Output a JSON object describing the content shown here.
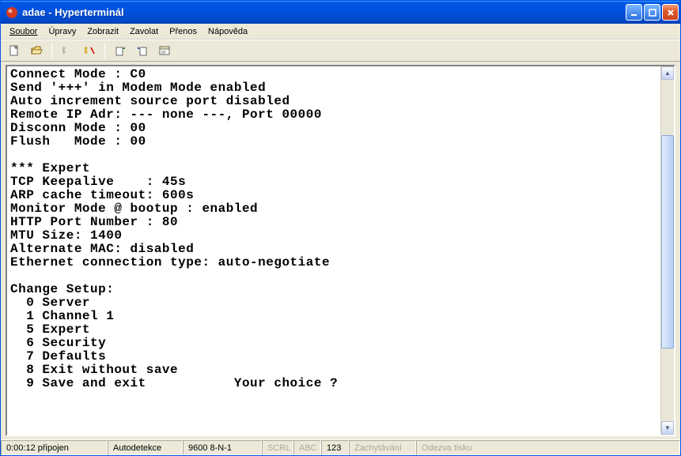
{
  "window": {
    "title": "adae - Hyperterminál"
  },
  "menu": {
    "file": "Soubor",
    "edit": "Úpravy",
    "view": "Zobrazit",
    "call": "Zavolat",
    "transfer": "Přenos",
    "help": "Nápověda"
  },
  "toolbar_icons": {
    "new": "new-file-icon",
    "open": "open-folder-icon",
    "connect": "phone-connect-icon",
    "disconnect": "phone-disconnect-icon",
    "send": "send-file-icon",
    "receive": "receive-file-icon",
    "properties": "properties-icon"
  },
  "terminal_lines": [
    "Connect Mode : C0",
    "Send '+++' in Modem Mode enabled",
    "Auto increment source port disabled",
    "Remote IP Adr: --- none ---, Port 00000",
    "Disconn Mode : 00",
    "Flush   Mode : 00",
    "",
    "*** Expert",
    "TCP Keepalive    : 45s",
    "ARP cache timeout: 600s",
    "Monitor Mode @ bootup : enabled",
    "HTTP Port Number : 80",
    "MTU Size: 1400",
    "Alternate MAC: disabled",
    "Ethernet connection type: auto-negotiate",
    "",
    "Change Setup:",
    "  0 Server",
    "  1 Channel 1",
    "  5 Expert",
    "  6 Security",
    "  7 Defaults",
    "  8 Exit without save",
    "  9 Save and exit           Your choice ? "
  ],
  "status": {
    "time_label": "0:00:12 připojen",
    "autodetect": "Autodetekce",
    "port_settings": "9600 8-N-1",
    "scrl": "SCRL",
    "abc": "ABC",
    "num": "123",
    "capture": "Zachytávání",
    "print_echo": "Odezva tisku"
  }
}
